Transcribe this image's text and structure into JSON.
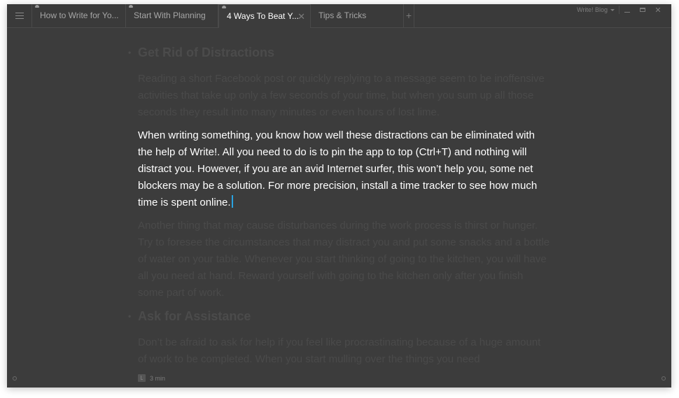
{
  "app": {
    "blog_selector": "Write! Blog",
    "window_controls": [
      "minimize",
      "maximize",
      "close"
    ]
  },
  "tabs": [
    {
      "label": "How to Write for Yo...",
      "cloud_synced": true,
      "active": false
    },
    {
      "label": "Start With Planning",
      "cloud_synced": true,
      "active": false
    },
    {
      "label": "4 Ways To Beat Y...",
      "cloud_synced": true,
      "active": true,
      "close_glyph": "✕"
    },
    {
      "label": "Tips & Tricks",
      "cloud_synced": false,
      "active": false
    }
  ],
  "add_tab_glyph": "+",
  "icons": {
    "menu": "hamburger-menu-icon",
    "cloud": "cloud-icon",
    "close": "close-icon",
    "add": "plus-icon",
    "clock": "clock-icon"
  },
  "document": {
    "sections": [
      {
        "heading": "Get Rid of Distractions",
        "paragraphs": [
          "Reading a short Facebook post or quickly replying to a message seem to be inoffensive activities that take up only a few seconds of your time, but when you sum up all those seconds they result into many minutes or even hours of lost lime.",
          "When writing something, you know how well these distractions can be eliminated with the help of Write!. All you need to do is to pin the app to top (Ctrl+T) and nothing will distract you. However, if you are an avid Internet surfer, this won’t help you, some net blockers may be a solution. For more precision, install a time tracker to see how much time is spent online.",
          "Another thing that may cause disturbances during the work process is thirst or hunger. Try to foresee the circumstances that may distract you and put some snacks and a bottle of water on your table. Whenever you start thinking of going to the kitchen, you will have all you need at hand. Reward yourself with going to the kitchen only after you finish some part of work."
        ]
      },
      {
        "heading": "Ask for Assistance",
        "paragraphs": [
          "Don’t be afraid to ask for help if you feel like procrastinating because of a huge amount of work to be completed. When you start mulling over the things you need"
        ]
      }
    ],
    "focused_paragraph": "section0.paragraph1"
  },
  "status": {
    "reading_time": "3 min"
  },
  "colors": {
    "background": "#3c3c3c",
    "focused_text": "#ffffff",
    "dimmed_text": "#4a4a4a",
    "cursor": "#2aa3e0"
  }
}
